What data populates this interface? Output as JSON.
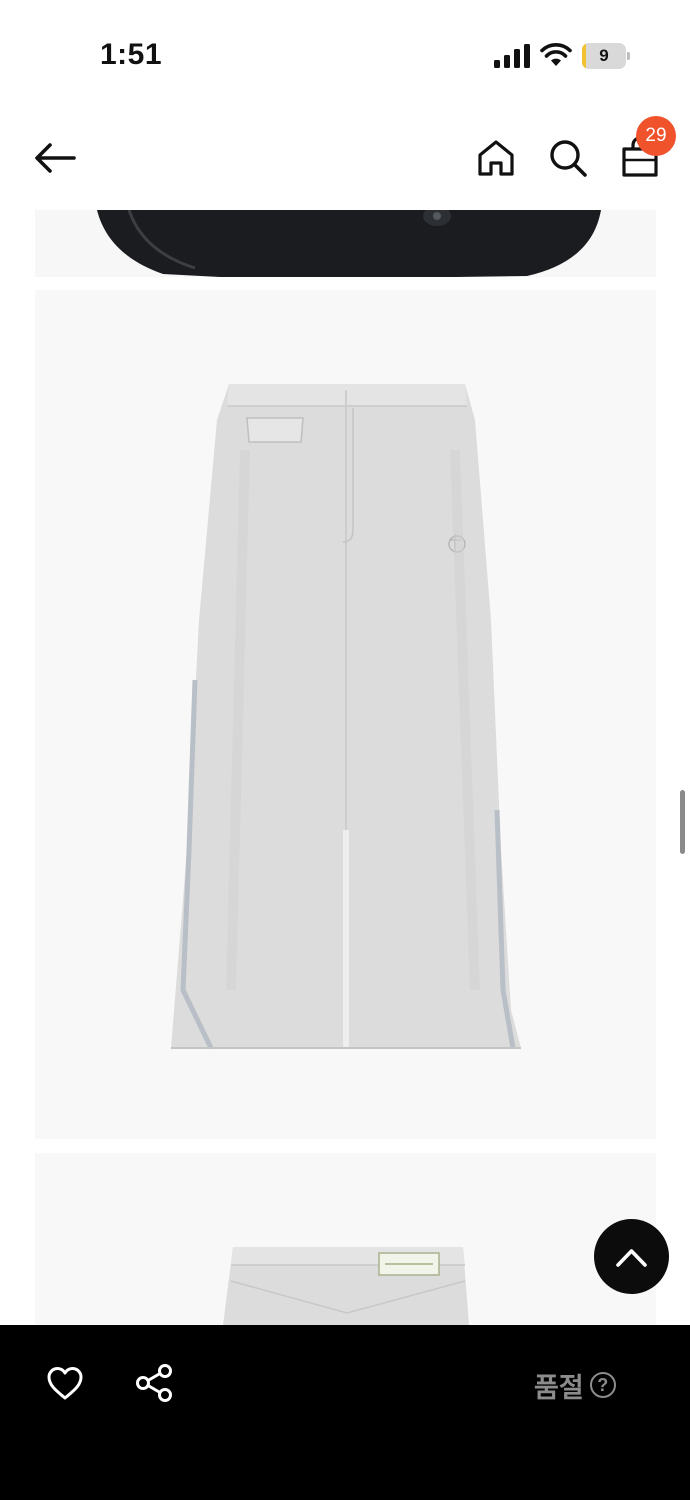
{
  "status_bar": {
    "time": "1:51",
    "battery_level": "9",
    "battery_fraction": 0.09,
    "icons": [
      "cellular-signal-icon",
      "wifi-icon",
      "battery-icon"
    ]
  },
  "nav": {
    "icons": [
      "back-arrow-icon",
      "home-icon",
      "search-icon",
      "shopping-bag-icon"
    ],
    "cart_count": "29",
    "badge_color": "#f0522b"
  },
  "content": {
    "images": [
      "product-image-dark-object-partial",
      "product-image-grey-maxi-skirt-front",
      "product-image-grey-skirt-back-partial"
    ],
    "background_color": "#f8f8f8"
  },
  "scroll_top": {
    "icon": "chevron-up-icon"
  },
  "bottom_bar": {
    "icons": [
      "heart-icon",
      "share-icon",
      "help-circle-icon"
    ],
    "soldout_label": "품절",
    "help_symbol": "?"
  }
}
